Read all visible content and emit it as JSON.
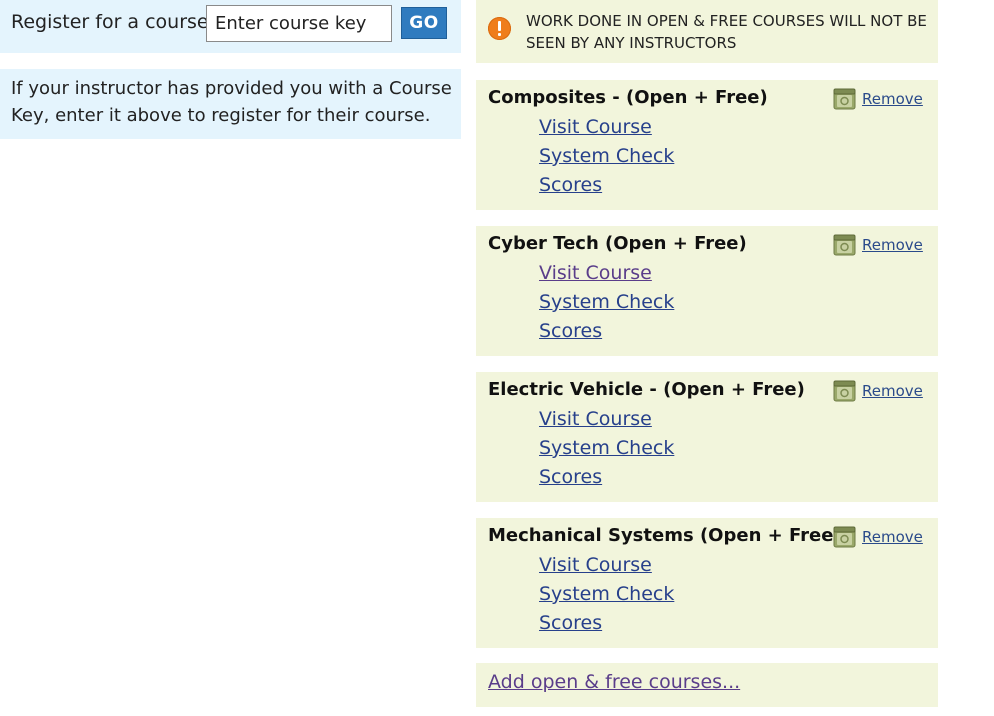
{
  "register": {
    "label": "Register for a course:",
    "input_placeholder": "Enter course key",
    "go_label": "GO"
  },
  "info": {
    "text": "If your instructor has provided you with a Course Key, enter it above to register for their course."
  },
  "warning": {
    "icon": "warning-icon",
    "text": "WORK DONE IN OPEN & FREE COURSES WILL NOT BE SEEN BY ANY INSTRUCTORS"
  },
  "courses": [
    {
      "title": "Composites - (Open + Free)",
      "remove_label": "Remove",
      "links": [
        "Visit Course",
        "System Check",
        "Scores"
      ]
    },
    {
      "title": "Cyber Tech (Open + Free)",
      "remove_label": "Remove",
      "links": [
        "Visit Course",
        "System Check",
        "Scores"
      ]
    },
    {
      "title": "Electric Vehicle - (Open + Free)",
      "remove_label": "Remove",
      "links": [
        "Visit Course",
        "System Check",
        "Scores"
      ]
    },
    {
      "title": "Mechanical Systems (Open + Free)",
      "remove_label": "Remove",
      "links": [
        "Visit Course",
        "System Check",
        "Scores"
      ]
    }
  ],
  "add_courses_label": "Add open & free courses...",
  "colors": {
    "register_bg": "#e4f4fd",
    "panel_bg": "#f2f5dc",
    "go_button": "#2f7bbf",
    "warning_icon": "#ef7d1c",
    "link": "#27408b",
    "visited_link": "#5a3d8a"
  }
}
